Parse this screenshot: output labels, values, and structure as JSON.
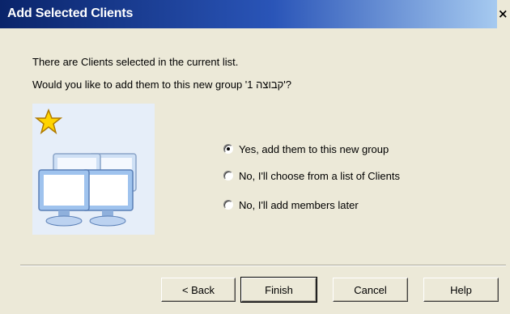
{
  "window": {
    "title": "Add Selected Clients",
    "close_glyph": "×"
  },
  "message": {
    "line1": "There are Clients selected in the current list.",
    "line2": "Would you like to add them to this new group '1 קבוצה'?"
  },
  "illustration": {
    "icons": [
      "star-icon",
      "computers-icon"
    ]
  },
  "options": [
    {
      "label": "Yes, add them to this new group",
      "selected": true
    },
    {
      "label": "No, I'll choose from a list of Clients",
      "selected": false
    },
    {
      "label": "No, I'll add members later",
      "selected": false
    }
  ],
  "buttons": {
    "back": "< Back",
    "finish": "Finish",
    "cancel": "Cancel",
    "help": "Help"
  },
  "colors": {
    "title_bar_start": "#0a246a",
    "title_bar_end": "#a6caf0",
    "dialog_bg": "#ece9d8",
    "star": "#ffd400"
  }
}
